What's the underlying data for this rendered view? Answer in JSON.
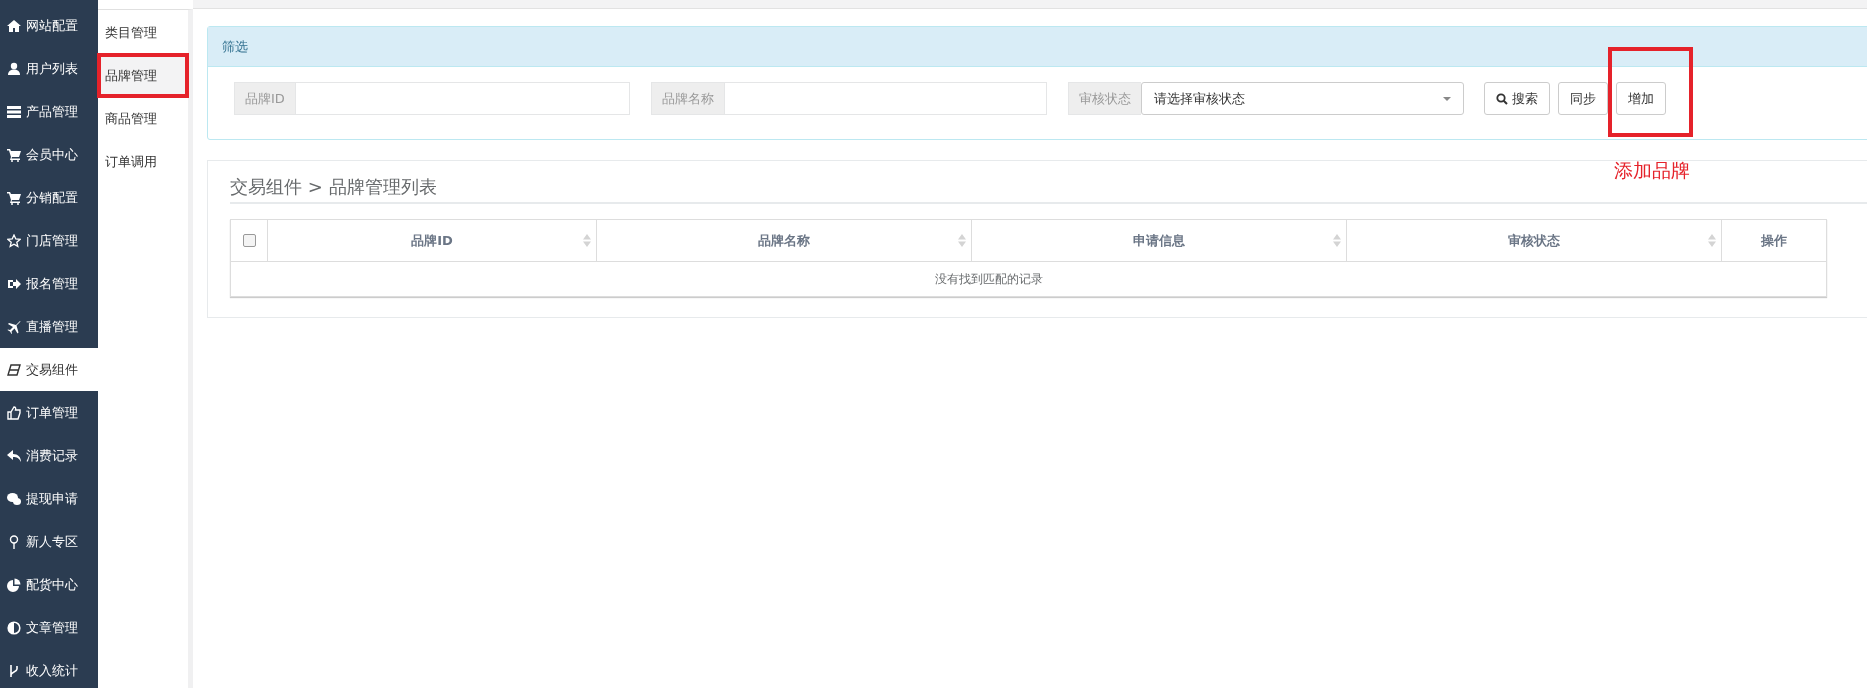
{
  "sidebar": {
    "items": [
      {
        "label": "网站配置",
        "selected": false
      },
      {
        "label": "用户列表",
        "selected": false
      },
      {
        "label": "产品管理",
        "selected": false
      },
      {
        "label": "会员中心",
        "selected": false
      },
      {
        "label": "分销配置",
        "selected": false
      },
      {
        "label": "门店管理",
        "selected": false
      },
      {
        "label": "报名管理",
        "selected": false
      },
      {
        "label": "直播管理",
        "selected": false
      },
      {
        "label": "交易组件",
        "selected": true
      },
      {
        "label": "订单管理",
        "selected": false
      },
      {
        "label": "消费记录",
        "selected": false
      },
      {
        "label": "提现申请",
        "selected": false
      },
      {
        "label": "新人专区",
        "selected": false
      },
      {
        "label": "配货中心",
        "selected": false
      },
      {
        "label": "文章管理",
        "selected": false
      },
      {
        "label": "收入统计",
        "selected": false
      }
    ]
  },
  "submenu": {
    "items": [
      {
        "label": "类目管理",
        "selected": false,
        "highlighted": false
      },
      {
        "label": "品牌管理",
        "selected": true,
        "highlighted": true
      },
      {
        "label": "商品管理",
        "selected": false,
        "highlighted": false
      },
      {
        "label": "订单调用",
        "selected": false,
        "highlighted": false
      }
    ]
  },
  "filter": {
    "title": "筛选",
    "fields": [
      {
        "kind": "input",
        "label": "品牌ID"
      },
      {
        "kind": "input",
        "label": "品牌名称"
      },
      {
        "kind": "select",
        "label": "审核状态",
        "value": "请选择审核状态"
      }
    ],
    "buttons": [
      {
        "kind": "search",
        "label": "搜索",
        "highlighted": false
      },
      {
        "kind": "plain",
        "label": "同步",
        "highlighted": false
      },
      {
        "kind": "plain",
        "label": "增加",
        "highlighted": true
      }
    ],
    "annotation": "添加品牌"
  },
  "list": {
    "title": "交易组件 > 品牌管理列表",
    "table": {
      "select_all_checked": false,
      "columns": [
        {
          "label": "品牌ID",
          "sortable": true
        },
        {
          "label": "品牌名称",
          "sortable": true
        },
        {
          "label": "申请信息",
          "sortable": true
        },
        {
          "label": "审核状态",
          "sortable": true
        },
        {
          "label": "操作",
          "sortable": false
        }
      ],
      "empty_message": "没有找到匹配的记录"
    }
  }
}
